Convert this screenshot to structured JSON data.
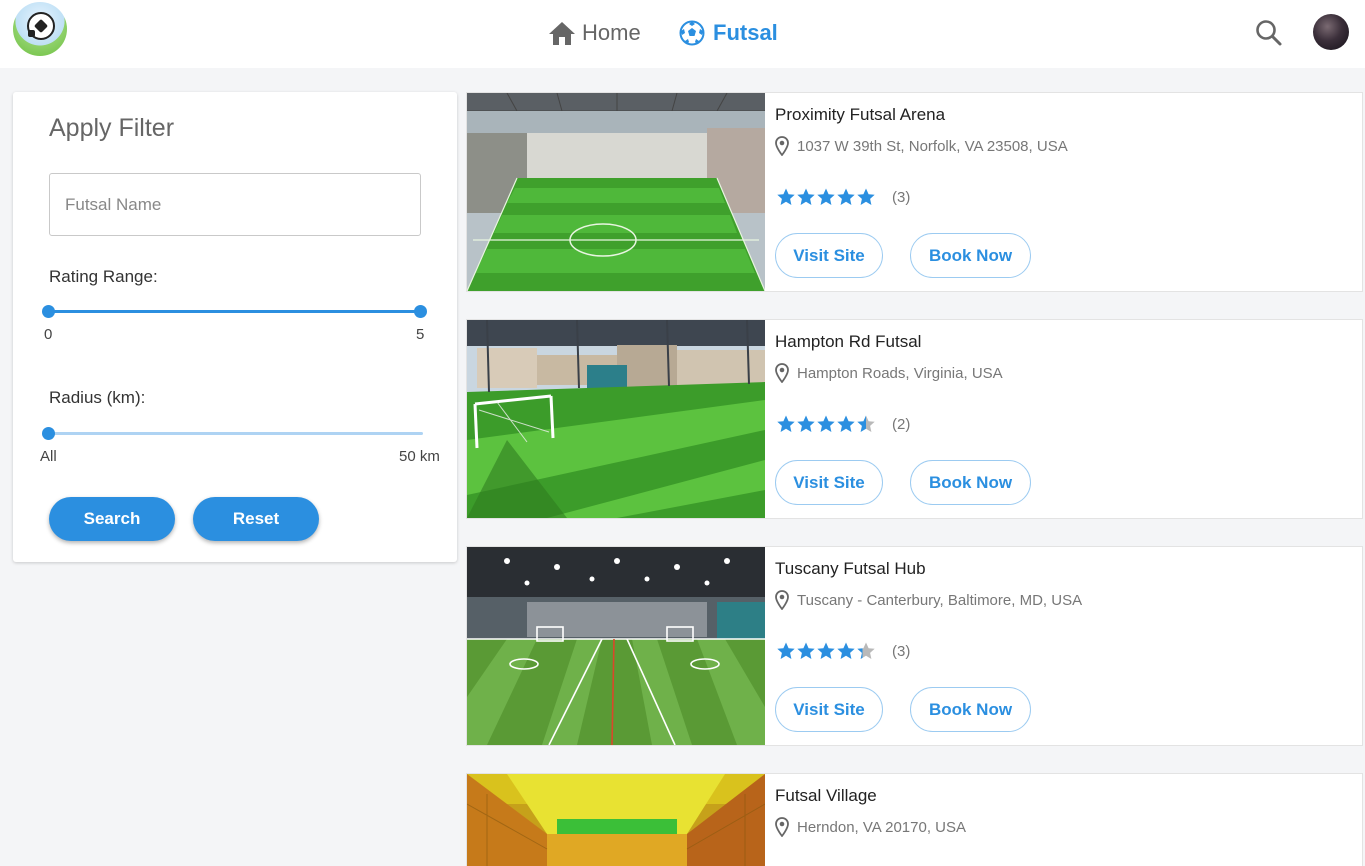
{
  "nav": {
    "home_label": "Home",
    "futsal_label": "Futsal",
    "logo_icon": "soccer-ball-logo",
    "home_icon": "home-icon",
    "futsal_icon": "soccer-ball-icon",
    "search_icon": "search-icon",
    "accent_color": "#2b8fe0"
  },
  "filter": {
    "title": "Apply Filter",
    "name_placeholder": "Futsal Name",
    "rating_label": "Rating Range:",
    "rating_min": "0",
    "rating_max": "5",
    "rating_range": [
      0,
      5
    ],
    "radius_label": "Radius (km):",
    "radius_min": "All",
    "radius_max": "50 km",
    "radius_value": 0,
    "search_label": "Search",
    "reset_label": "Reset"
  },
  "futsals": [
    {
      "name": "Proximity Futsal Arena",
      "address": "1037 W 39th St, Norfolk, VA 23508, USA",
      "rating": 5,
      "reviews": "(3)",
      "visit_label": "Visit Site",
      "book_label": "Book Now"
    },
    {
      "name": "Hampton Rd Futsal",
      "address": "Hampton Roads, Virginia, USA",
      "rating": 4.5,
      "reviews": "(2)",
      "visit_label": "Visit Site",
      "book_label": "Book Now"
    },
    {
      "name": "Tuscany Futsal Hub",
      "address": "Tuscany - Canterbury, Baltimore, MD, USA",
      "rating": 4.3,
      "reviews": "(3)",
      "visit_label": "Visit Site",
      "book_label": "Book Now"
    },
    {
      "name": "Futsal Village",
      "address": "Herndon, VA 20170, USA"
    }
  ]
}
